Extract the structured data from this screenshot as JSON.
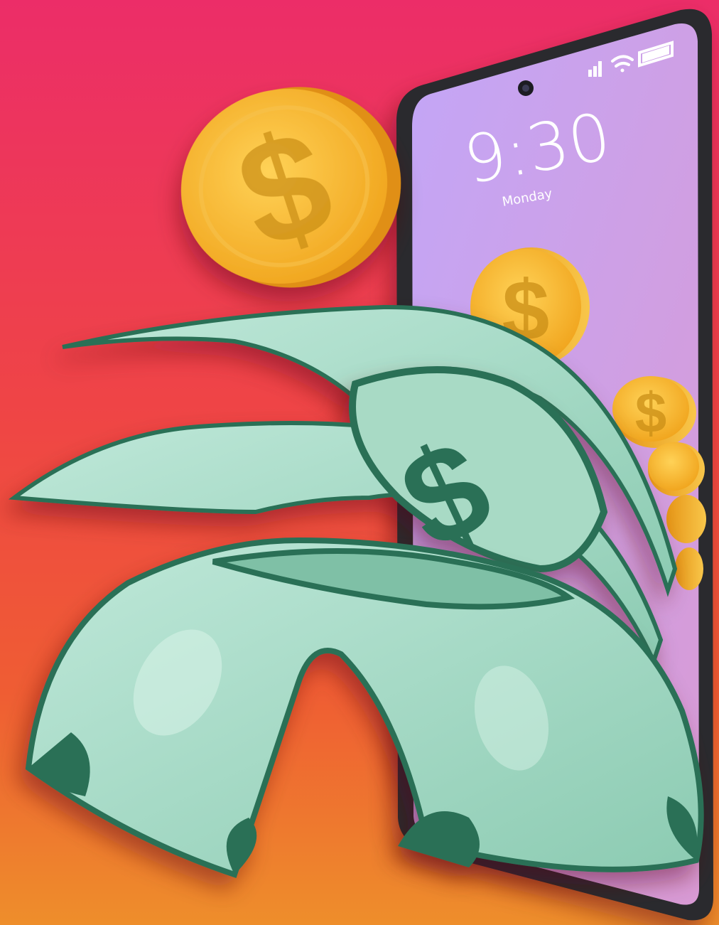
{
  "lockscreen": {
    "time": "9:30",
    "day": "Monday"
  },
  "icons": {
    "coin_symbol": "$",
    "bill_symbol": "$",
    "signal": "signal-icon",
    "wifi": "wifi-icon",
    "battery": "battery-icon"
  },
  "colors": {
    "background_top": "#ec2f66",
    "background_mid": "#ef4b3d",
    "background_bottom": "#ef8a2c",
    "phone_screen": "#c8a3ee",
    "coin": "#f3b324",
    "bill_light": "#a9dcc8",
    "bill_dark": "#2b6f57"
  }
}
